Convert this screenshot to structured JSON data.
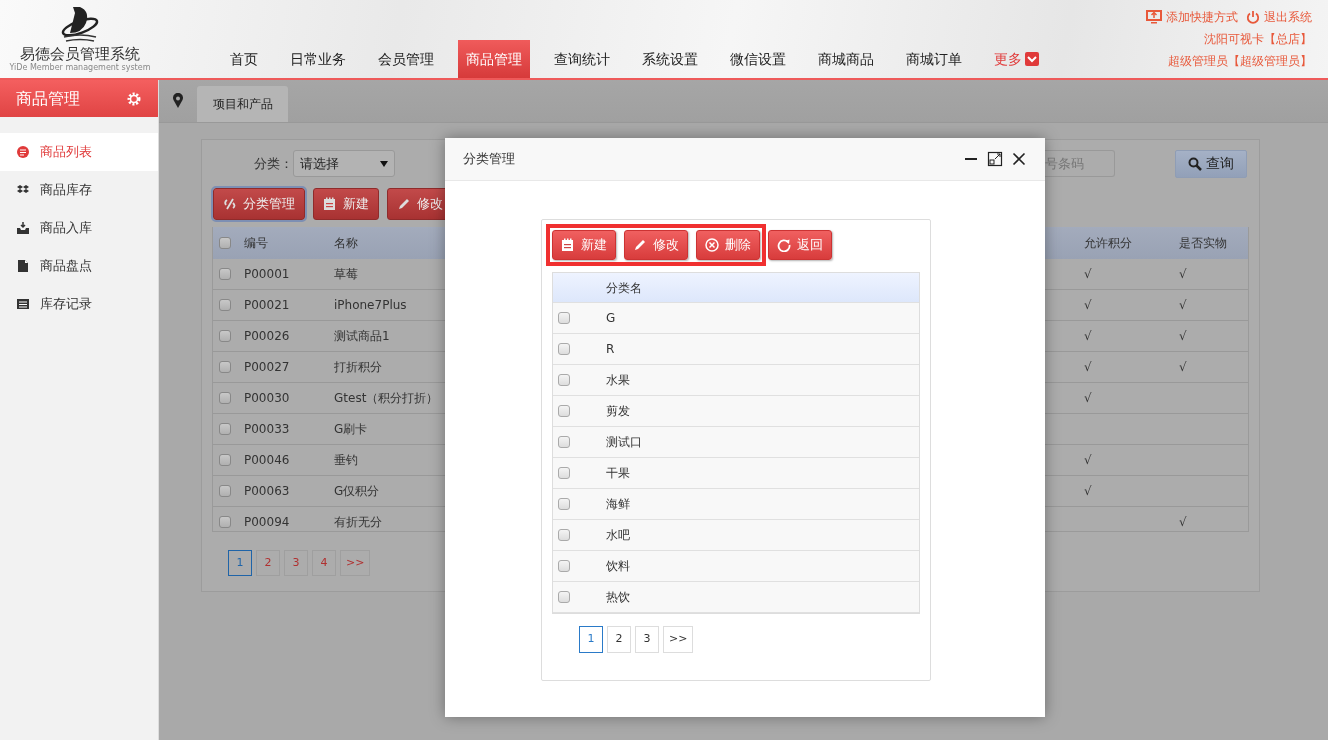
{
  "app": {
    "title": "易德会员管理系统",
    "subtitle": "YiDe Member management system"
  },
  "nav": [
    {
      "label": "首页",
      "selected": false,
      "kind": "item"
    },
    {
      "label": "日常业务",
      "selected": false,
      "kind": "item"
    },
    {
      "label": "会员管理",
      "selected": false,
      "kind": "item"
    },
    {
      "label": "商品管理",
      "selected": true,
      "kind": "item"
    },
    {
      "label": "查询统计",
      "selected": false,
      "kind": "item"
    },
    {
      "label": "系统设置",
      "selected": false,
      "kind": "item"
    },
    {
      "label": "微信设置",
      "selected": false,
      "kind": "item"
    },
    {
      "label": "商城商品",
      "selected": false,
      "kind": "item"
    },
    {
      "label": "商城订单",
      "selected": false,
      "kind": "item"
    },
    {
      "label": "更多",
      "selected": false,
      "kind": "more"
    }
  ],
  "user_links": [
    {
      "label": "添加快捷方式",
      "kind": "shortcut"
    },
    {
      "label": "退出系统",
      "kind": "logout"
    }
  ],
  "store": "沈阳可视卡【总店】",
  "user": "超级管理员【超级管理员】",
  "sidebar": {
    "title": "商品管理",
    "items": [
      {
        "label": "商品列表",
        "kind": "list",
        "selected": true
      },
      {
        "label": "商品库存",
        "kind": "stock",
        "selected": false
      },
      {
        "label": "商品入库",
        "kind": "inbound",
        "selected": false
      },
      {
        "label": "商品盘点",
        "kind": "check",
        "selected": false
      },
      {
        "label": "库存记录",
        "kind": "record",
        "selected": false
      }
    ]
  },
  "tab": {
    "label": "项目和产品"
  },
  "filter": {
    "label": "分类：",
    "select_value": "请选择",
    "search_placeholder": "号条码",
    "search_button": "查询"
  },
  "toolbar": [
    {
      "label": "分类管理",
      "kind": "category",
      "focused": true
    },
    {
      "label": "新建",
      "kind": "new",
      "focused": false
    },
    {
      "label": "修改",
      "kind": "edit",
      "focused": false
    }
  ],
  "table": {
    "header_checked": false,
    "columns": [
      "编号",
      "名称",
      "允许积分",
      "是否实物"
    ],
    "rows": [
      {
        "checked": false,
        "code": "P00001",
        "name": "草莓",
        "points": "√",
        "physical": "√"
      },
      {
        "checked": false,
        "code": "P00021",
        "name": "iPhone7Plus",
        "points": "√",
        "physical": "√"
      },
      {
        "checked": false,
        "code": "P00026",
        "name": "测试商品1",
        "points": "√",
        "physical": "√"
      },
      {
        "checked": false,
        "code": "P00027",
        "name": "打折积分",
        "points": "√",
        "physical": "√"
      },
      {
        "checked": false,
        "code": "P00030",
        "name": "Gtest（积分打折）",
        "points": "√"
      },
      {
        "checked": false,
        "code": "P00033",
        "name": "G刷卡"
      },
      {
        "checked": false,
        "code": "P00046",
        "name": "垂钓",
        "points": "√"
      },
      {
        "checked": false,
        "code": "P00063",
        "name": "G仅积分",
        "points": "√"
      },
      {
        "checked": false,
        "code": "P00094",
        "name": "有折无分",
        "physical": "√"
      }
    ]
  },
  "pagination": [
    {
      "label": "1",
      "selected": true
    },
    {
      "label": "2",
      "selected": false
    },
    {
      "label": "3",
      "selected": false
    },
    {
      "label": "4",
      "selected": false
    },
    {
      "label": ">>",
      "selected": false
    }
  ],
  "dialog": {
    "title": "分类管理",
    "toolbar": [
      {
        "label": "新建",
        "kind": "new",
        "highlighted": true
      },
      {
        "label": "修改",
        "kind": "edit",
        "highlighted": true
      },
      {
        "label": "删除",
        "kind": "delete",
        "highlighted": true
      },
      {
        "label": "返回",
        "kind": "back",
        "highlighted": false
      }
    ],
    "columns": [
      "分类名"
    ],
    "rows": [
      {
        "name": "G",
        "checked": false
      },
      {
        "name": "R",
        "checked": false
      },
      {
        "name": "水果",
        "checked": false
      },
      {
        "name": "剪发",
        "checked": false
      },
      {
        "name": "测试口",
        "checked": false
      },
      {
        "name": "干果",
        "checked": false
      },
      {
        "name": "海鲜",
        "checked": false
      },
      {
        "name": "水吧",
        "checked": false
      },
      {
        "name": "饮料",
        "checked": false
      },
      {
        "name": "热饮",
        "checked": false
      }
    ],
    "pagination": [
      {
        "label": "1",
        "selected": true
      },
      {
        "label": "2",
        "selected": false
      },
      {
        "label": "3",
        "selected": false
      },
      {
        "label": ">>",
        "selected": false
      }
    ]
  }
}
